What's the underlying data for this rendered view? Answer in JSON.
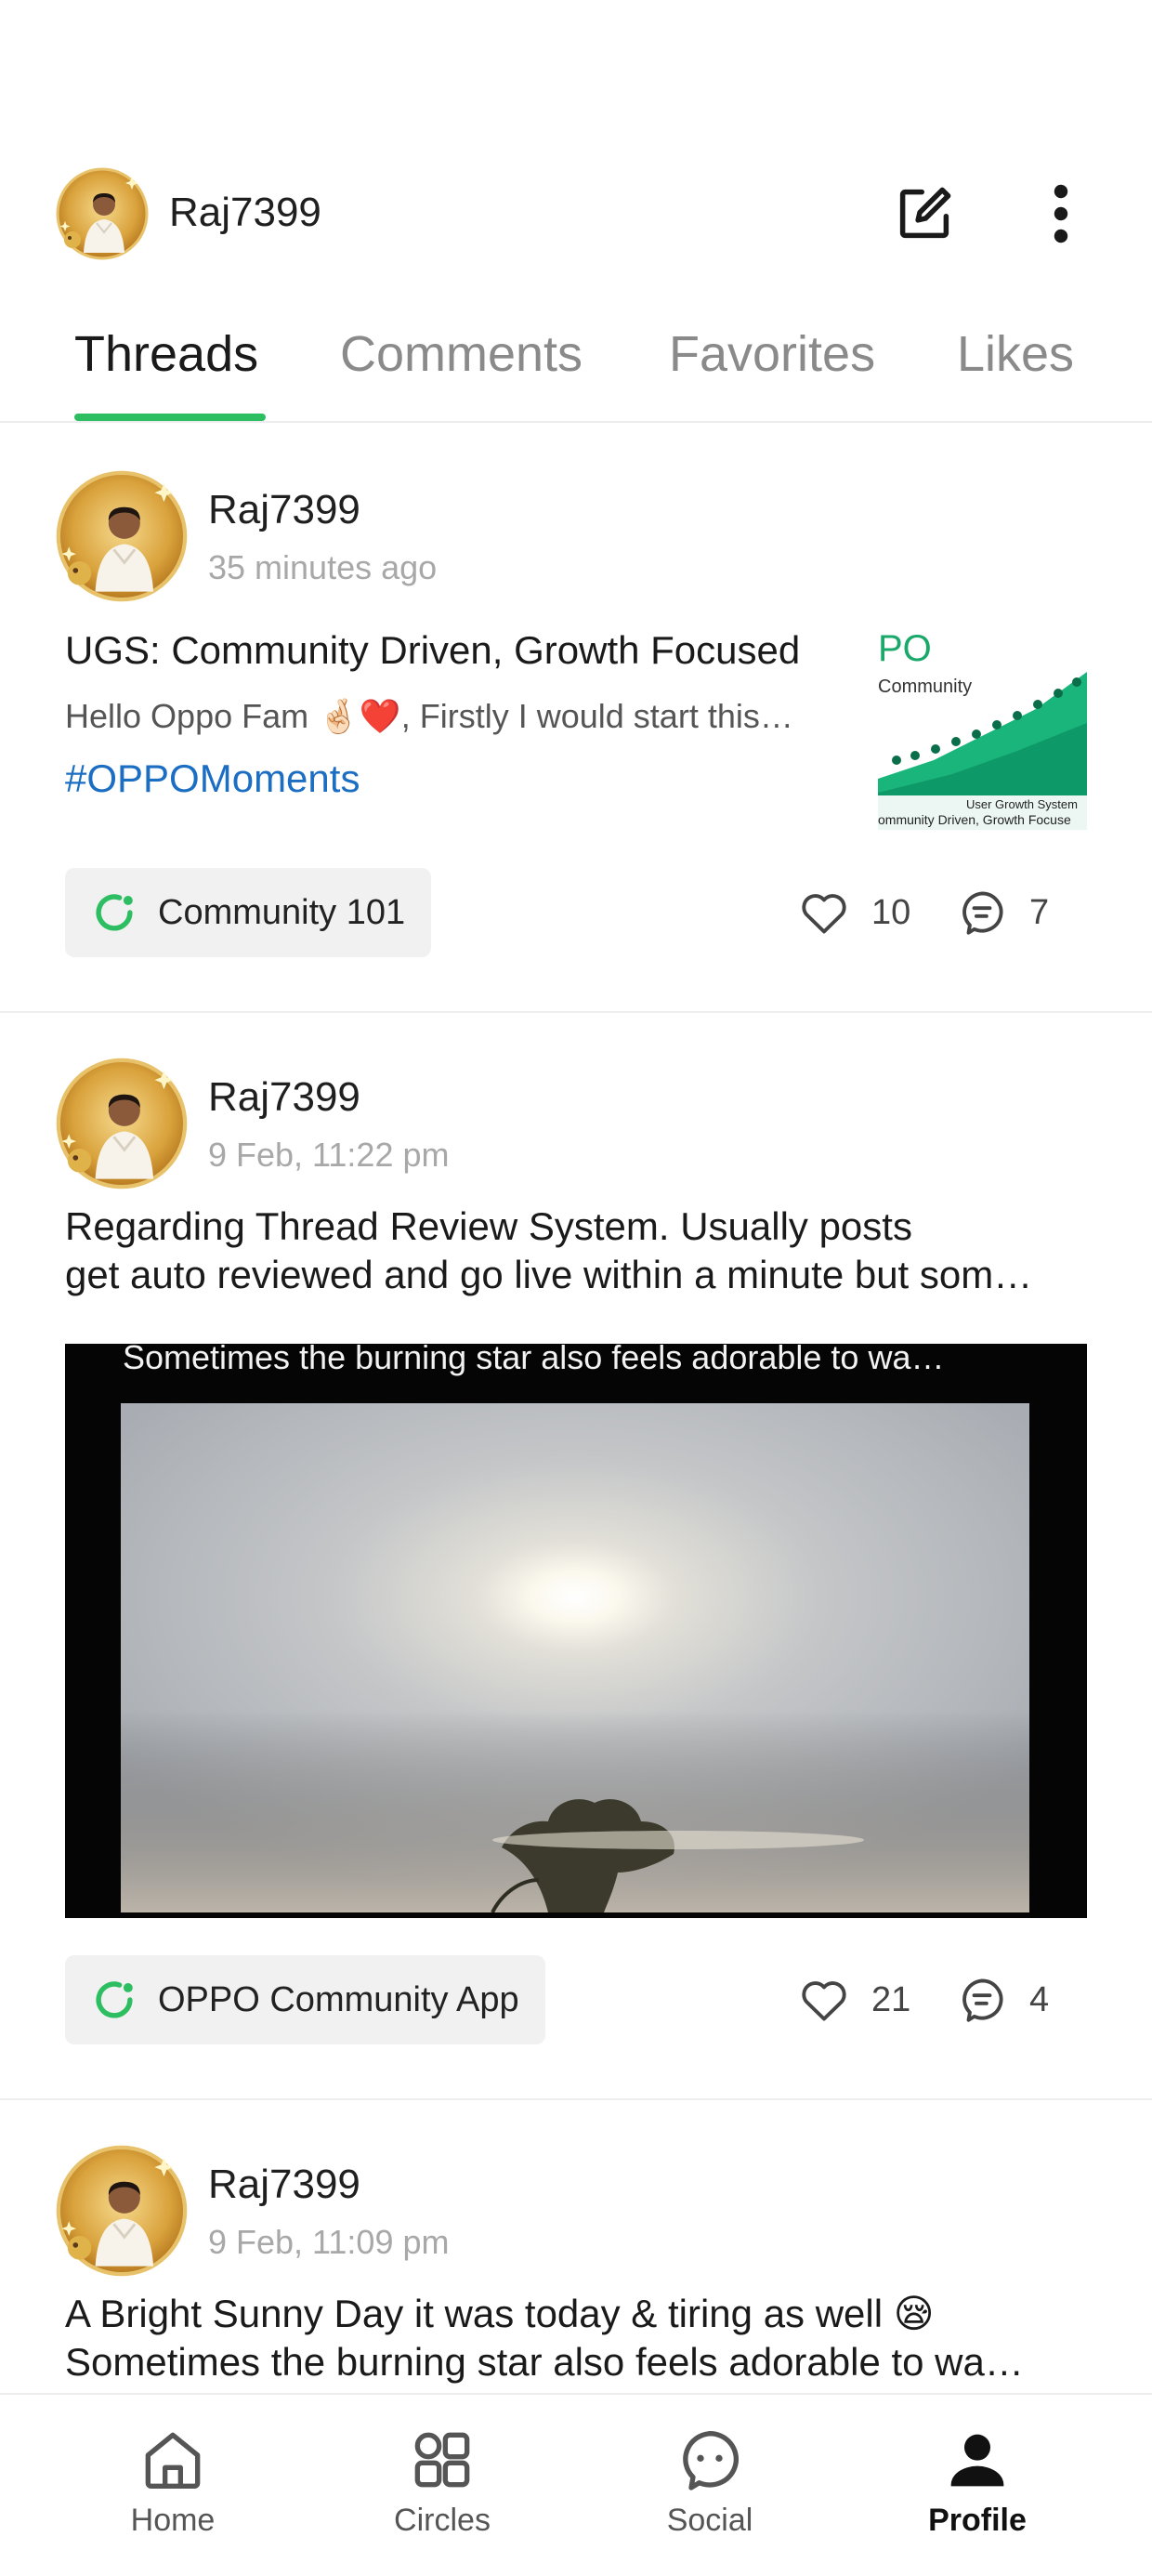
{
  "header": {
    "username": "Raj7399",
    "icons": {
      "edit": "edit-square-icon",
      "more": "more-vertical-icon"
    }
  },
  "tabs": [
    {
      "label": "Threads",
      "active": true
    },
    {
      "label": "Comments",
      "active": false
    },
    {
      "label": "Favorites",
      "active": false
    },
    {
      "label": "Likes",
      "active": false
    }
  ],
  "colors": {
    "accent": "#2dbe62",
    "hashtag": "#1b6ec2",
    "muted": "#a8a8a8"
  },
  "posts": [
    {
      "author": "Raj7399",
      "time": "35 minutes ago",
      "title": "UGS: Community Driven, Growth Focused",
      "excerpt": "Hello Oppo Fam 🤞🏻❤️, Firstly I would start this…",
      "hashtag": "#OPPOMoments",
      "thumbnail": {
        "brand": "PO",
        "brand_sub": "Community",
        "caption1": "User Growth System",
        "caption2": "ommunity Driven, Growth Focuse"
      },
      "circle": "Community 101",
      "likes": "10",
      "comments": "7"
    },
    {
      "author": "Raj7399",
      "time": "9 Feb, 11:22 pm",
      "title_line1": "Regarding Thread Review System. Usually posts",
      "title_line2": "get auto reviewed and go live within a minute but som…",
      "video_caption": "Sometimes the burning star also feels adorable to wa…",
      "circle": "OPPO Community App",
      "likes": "21",
      "comments": "4"
    },
    {
      "author": "Raj7399",
      "time": "9 Feb, 11:09 pm",
      "title_line1": "A Bright Sunny Day it was today & tiring as well 😪",
      "title_line2": "Sometimes the burning star also feels adorable to wa…"
    }
  ],
  "bottom_nav": [
    {
      "label": "Home",
      "icon": "home-icon",
      "active": false
    },
    {
      "label": "Circles",
      "icon": "circles-grid-icon",
      "active": false
    },
    {
      "label": "Social",
      "icon": "chat-bubble-icon",
      "active": false
    },
    {
      "label": "Profile",
      "icon": "person-icon",
      "active": true
    }
  ]
}
